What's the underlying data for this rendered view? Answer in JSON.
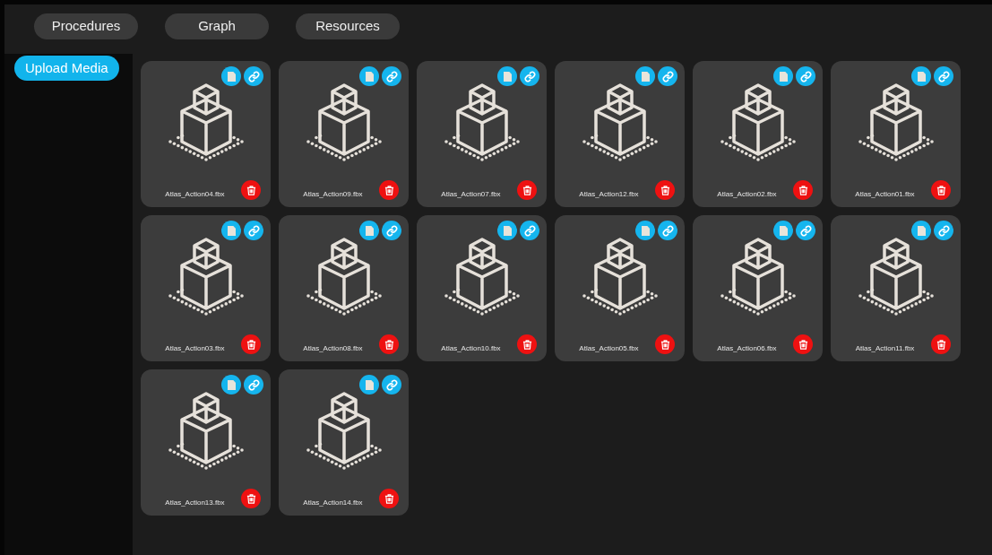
{
  "tabs": [
    {
      "label": "Procedures"
    },
    {
      "label": "Graph"
    },
    {
      "label": "Resources"
    }
  ],
  "sidebar": {
    "upload_button": "Upload Media"
  },
  "media": [
    {
      "name": "Atlas_Action04.fbx"
    },
    {
      "name": "Atlas_Action09.fbx"
    },
    {
      "name": "Atlas_Action07.fbx"
    },
    {
      "name": "Atlas_Action12.fbx"
    },
    {
      "name": "Atlas_Action02.fbx"
    },
    {
      "name": "Atlas_Action01.fbx"
    },
    {
      "name": "Atlas_Action03.fbx"
    },
    {
      "name": "Atlas_Action08.fbx"
    },
    {
      "name": "Atlas_Action10.fbx"
    },
    {
      "name": "Atlas_Action05.fbx"
    },
    {
      "name": "Atlas_Action06.fbx"
    },
    {
      "name": "Atlas_Action11.fbx"
    },
    {
      "name": "Atlas_Action13.fbx"
    },
    {
      "name": "Atlas_Action14.fbx"
    }
  ]
}
